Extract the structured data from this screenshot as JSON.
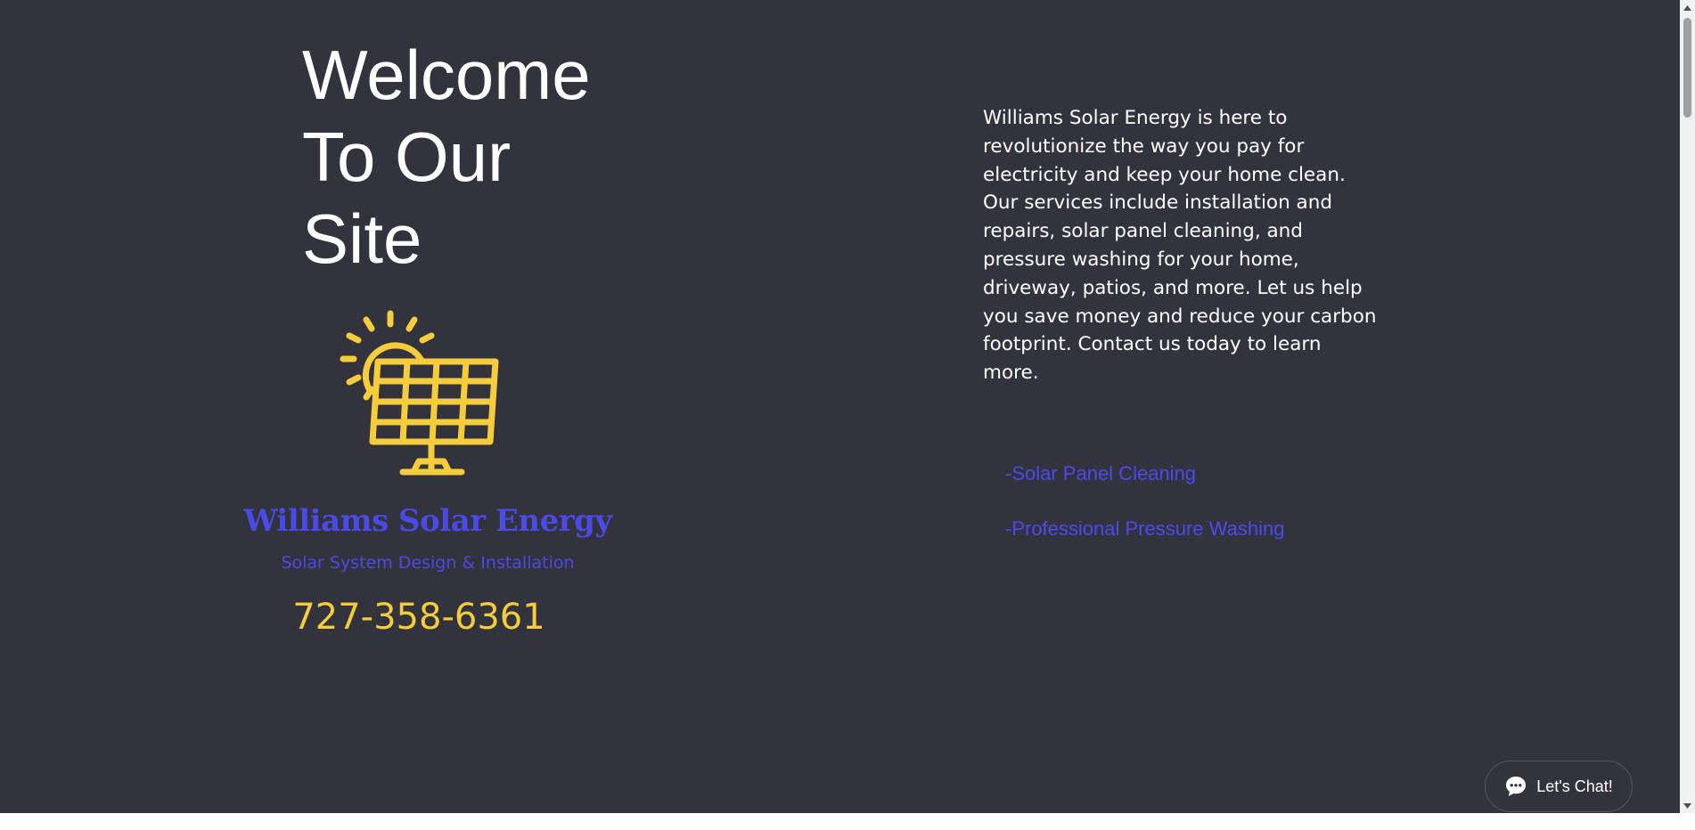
{
  "hero": {
    "welcome_title": "Welcome\nTo Our\nSite"
  },
  "brand": {
    "logo_icon": "solar-panel-sun-icon",
    "name": "Williams Solar Energy",
    "tagline": "Solar System Design & Installation",
    "phone": "727-358-6361",
    "colors": {
      "brand_blue": "#4a4ae6",
      "accent_yellow": "#f4cc3c",
      "background": "#33333e"
    }
  },
  "about": {
    "text": "Williams Solar Energy is here to revolutionize the way you pay for electricity and keep your home clean. Our services include installation and repairs, solar panel cleaning, and pressure washing for your home, driveway, patios, and more. Let us help you save money and reduce your carbon footprint. Contact us today to learn more."
  },
  "services": [
    {
      "label": "-Solar Panel Cleaning"
    },
    {
      "label": "-Professional Pressure Washing"
    }
  ],
  "chat": {
    "label": "Let's Chat!",
    "icon": "chat-bubble-icon"
  }
}
